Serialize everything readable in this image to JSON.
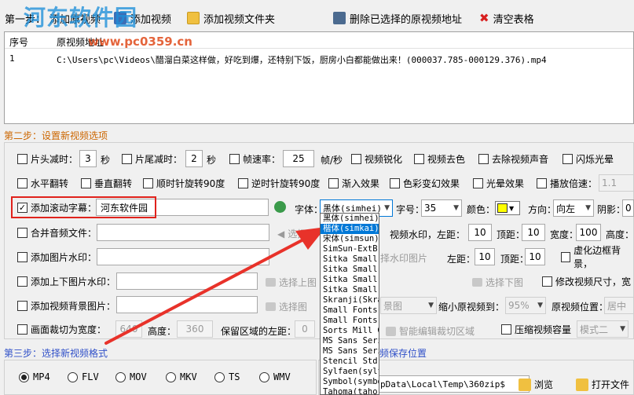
{
  "toolbar": {
    "step1_label": "第一步：",
    "add_original": "添加原视频",
    "add_video": "添加视频",
    "add_folder": "添加视频文件夹",
    "delete_selected": "删除已选择的原视频地址",
    "clear_table": "清空表格"
  },
  "watermark": {
    "site": "河东软件园",
    "url": "www.pc0359.cn"
  },
  "file_table": {
    "col_index": "序号",
    "col_path": "原视频地址",
    "rows": [
      {
        "index": "1",
        "path": "C:\\Users\\pc\\Videos\\醋溜白菜这样做，好吃到爆，还特别下饭，厨房小白都能做出来！(000037.785-000129.376).mp4"
      }
    ]
  },
  "step2": {
    "title": "第二步：设置新视频选项",
    "head_trim": {
      "label": "片头减时：",
      "value": "3",
      "unit": "秒"
    },
    "tail_trim": {
      "label": "片尾减时：",
      "value": "2",
      "unit": "秒"
    },
    "frame_rate": {
      "label": "帧速率：",
      "value": "25",
      "unit": "帧/秒"
    },
    "sharpen": "视频锐化",
    "decolor": "视频去色",
    "remove_audio": "去除视频声音",
    "flash_halo": "闪烁光晕",
    "hflip": "水平翻转",
    "vflip": "垂直翻转",
    "rotate_cw": "顺时针旋转90度",
    "rotate_ccw": "逆时针旋转90度",
    "fade_in": "渐入效果",
    "color_shift": "色彩变幻效果",
    "halo": "光晕效果",
    "speed_label": "播放倍速：",
    "speed_value": "1.1",
    "scroll_caption": {
      "label": "添加滚动字幕：",
      "value": "河东软件园",
      "checked": true
    },
    "font_label": "字体：",
    "font_value": "黑体(simhei)",
    "size_label": "字号：",
    "size_value": "35",
    "color_label": "颜色：",
    "color_value": "#ffff00",
    "direction_label": "方向：",
    "direction_value": "向左",
    "shadow_label": "阴影：",
    "shadow_value": "0",
    "merge_audio": "合并音频文件：",
    "select_audio": "选择音",
    "video_wm": "视频水印，左距：",
    "wm_left": "10",
    "top_label": "顶距：",
    "wm_top": "10",
    "width_label": "宽度：",
    "wm_width": "100",
    "height_label": "高度：",
    "add_image_wm": "添加图片水印：",
    "select_wm_image": "择水印图片",
    "left_label": "左距：",
    "img_left": "10",
    "img_top": "10",
    "blur_border": "虚化边框背景，",
    "add_topbottom_wm": "添加上下图片水印：",
    "select_top_image": "选择上图",
    "select_bottom_image": "选择下图",
    "modify_size": "修改视频尺寸，宽",
    "add_bg_image": "添加视频背景图片：",
    "select_image": "选择图",
    "bg_image_combo": "景图",
    "shrink_label": "缩小原视频到：",
    "shrink_value": "95%",
    "position_label": "原视频位置：",
    "position_value": "居中",
    "crop": {
      "label": "画面裁切为宽度：",
      "width": "640",
      "height_label": "高度：",
      "height": "360",
      "keep_left_label": "保留区域的左距：",
      "left": "0"
    },
    "smart_crop": "智能编辑裁切区域",
    "compress": "压缩视频容量",
    "compress_mode": "模式二"
  },
  "step3": {
    "title": "第三步：选择新视频格式",
    "formats": [
      "MP4",
      "FLV",
      "MOV",
      "MKV",
      "TS",
      "WMV"
    ],
    "selected": "MP4"
  },
  "step4": {
    "title_suffix": "频保存位置",
    "path": "pData\\Local\\Temp\\360zip$",
    "browse": "浏览",
    "open_folder": "打开文件"
  },
  "font_dropdown": {
    "options": [
      "黑体(simhei)",
      "楷体(simkai)",
      "宋体(simsun)",
      "SimSun-ExtB(",
      "Sitka Small(",
      "Sitka Small(",
      "Sitka Small(",
      "Sitka Small(",
      "Skranji(Skra",
      "Small Fonts(",
      "Small Fonts(",
      "Sorts Mill G",
      "MS Sans Seri",
      "MS Sans Seri",
      "Stencil Std(",
      "Sylfaen(sylf",
      "Symbol(symbo",
      "Tahoma(taho"
    ],
    "selected_index": 1
  }
}
